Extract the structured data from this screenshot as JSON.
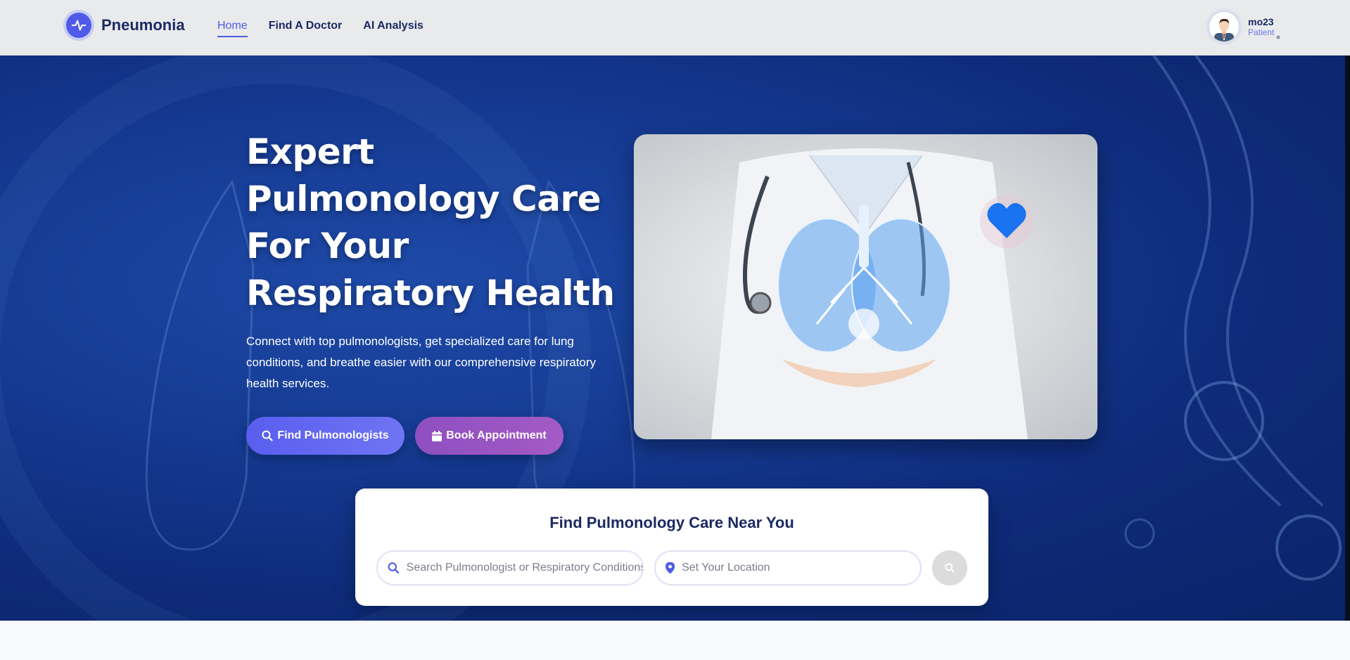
{
  "brand": {
    "name": "Pneumonia"
  },
  "nav": [
    {
      "label": "Home",
      "active": true
    },
    {
      "label": "Find A Doctor",
      "active": false
    },
    {
      "label": "AI Analysis",
      "active": false
    }
  ],
  "user": {
    "name": "mo23",
    "role": "Patient"
  },
  "hero": {
    "title_lines": [
      "Expert",
      "Pulmonology Care",
      "For Your",
      "Respiratory Health"
    ],
    "description": "Connect with top pulmonologists, get specialized care for lung conditions, and breathe easier with our comprehensive respiratory health services.",
    "btn_find": "Find Pulmonologists",
    "btn_book": "Book Appointment"
  },
  "search": {
    "title": "Find Pulmonology Care Near You",
    "query_placeholder": "Search Pulmonologist or Respiratory Conditions",
    "location_placeholder": "Set Your Location"
  },
  "colors": {
    "accent": "#4f5be8",
    "navy": "#1a2a63",
    "book": "#9b55c4"
  }
}
